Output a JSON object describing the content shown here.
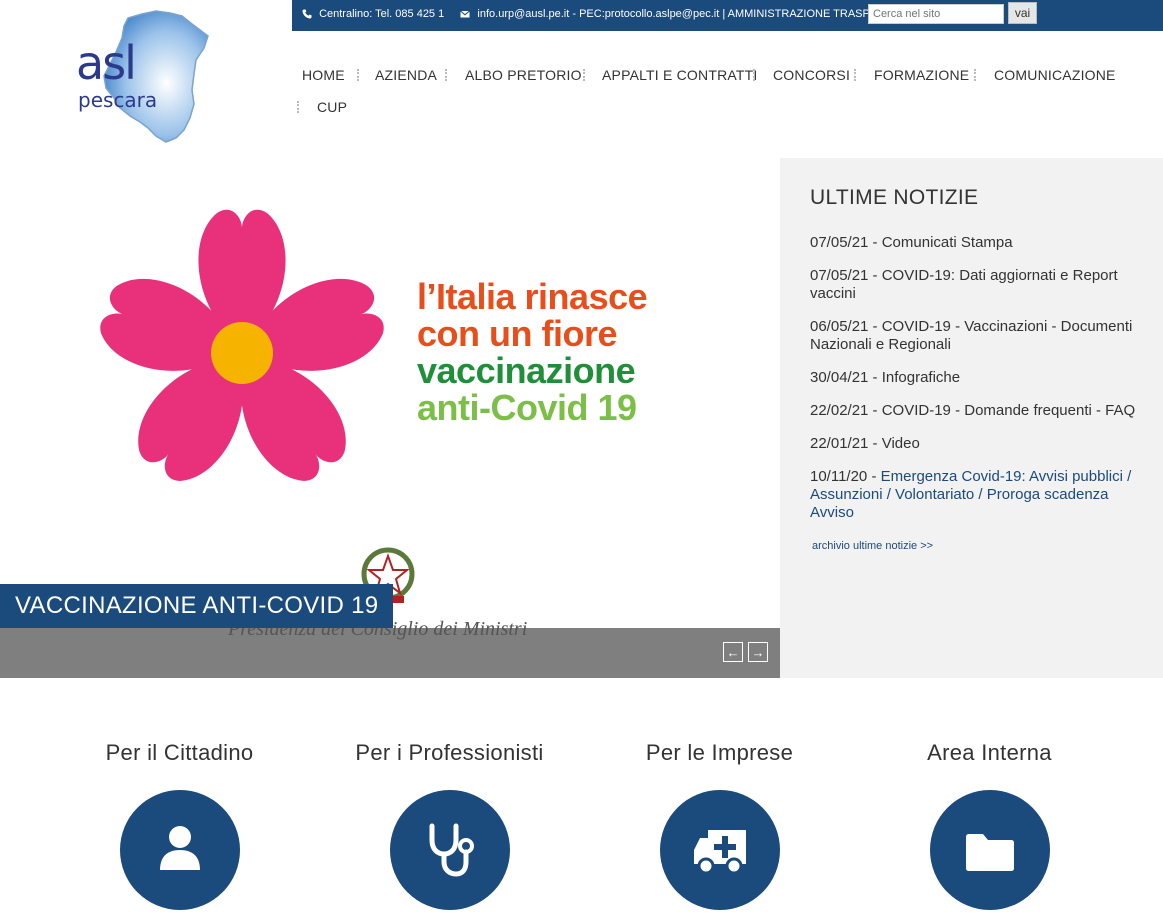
{
  "topbar": {
    "phone": "Centralino: Tel. 085 425 1",
    "email": "info.urp@ausl.pe.it - PEC:protocollo.aslpe@pec.it | AMMINISTRAZIONE TRASPARENTE",
    "search_placeholder": "Cerca nel sito",
    "search_button": "vai",
    "phone_icon": "phone-icon",
    "email_icon": "envelope-icon"
  },
  "logo": {
    "line1": "asl",
    "line2": "pescara"
  },
  "nav": {
    "items": [
      "HOME",
      "AZIENDA",
      "ALBO PRETORIO",
      "APPALTI E CONTRATTI",
      "CONCORSI",
      "FORMAZIONE",
      "COMUNICAZIONE",
      "CUP"
    ]
  },
  "slider": {
    "caption": "VACCINAZIONE ANTI-COVID 19",
    "slogan": [
      "l’Italia rinasce",
      "con un fiore",
      "vaccinazione",
      "anti-Covid 19"
    ],
    "ministry": "Presidenza del Consiglio dei Ministri",
    "prev": "←",
    "next": "→"
  },
  "news": {
    "heading": "ULTIME NOTIZIE",
    "items": [
      {
        "date": "07/05/21 - ",
        "title": "Comunicati Stampa"
      },
      {
        "date": "07/05/21 - ",
        "title": "COVID-19: Dati aggiornati e Report vaccini"
      },
      {
        "date": "06/05/21 - ",
        "title": "COVID-19 - Vaccinazioni - Documenti Nazionali e Regionali"
      },
      {
        "date": "30/04/21 - ",
        "title": "Infografiche"
      },
      {
        "date": "22/02/21 - ",
        "title": "COVID-19 - Domande frequenti - FAQ"
      },
      {
        "date": "22/01/21 - ",
        "title": "Video"
      },
      {
        "date": "10/11/20 - ",
        "title": "Emergenza Covid-19: Avvisi pubblici / Assunzioni / Volontariato / Proroga scadenza Avviso"
      }
    ],
    "archive": "archivio ultime notizie >>"
  },
  "sections": [
    {
      "title": "Per il Cittadino",
      "icon": "user-icon"
    },
    {
      "title": "Per i Professionisti",
      "icon": "stethoscope-icon"
    },
    {
      "title": "Per le Imprese",
      "icon": "ambulance-icon"
    },
    {
      "title": "Area Interna",
      "icon": "folder-icon"
    }
  ],
  "colors": {
    "brand": "#1b4a7c",
    "news_bg": "#f2f2f2",
    "flower": "#e8317a",
    "flower_center": "#f6b400"
  }
}
